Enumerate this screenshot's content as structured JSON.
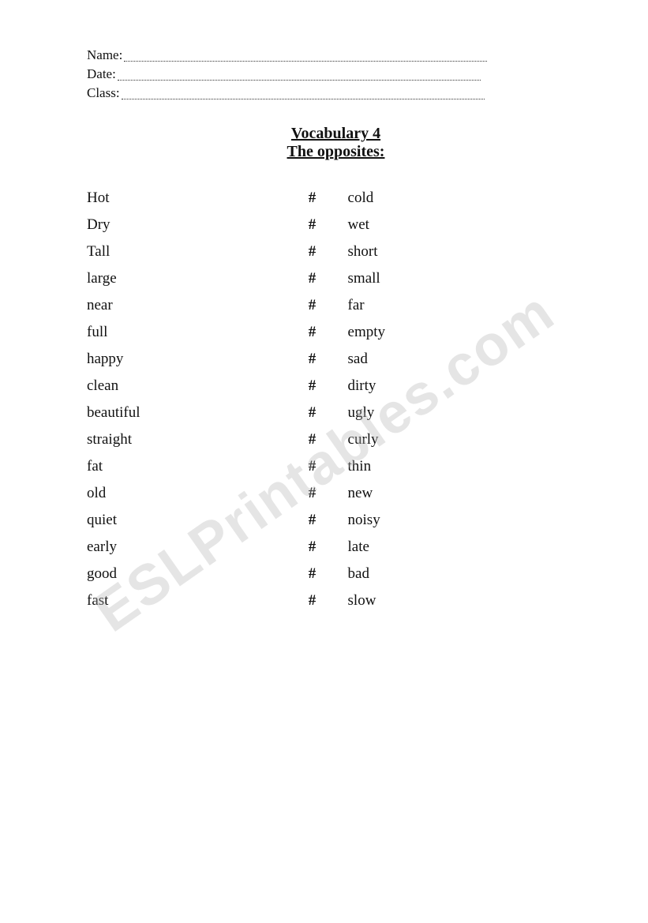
{
  "watermark": "ESLPrintables.com",
  "header": {
    "name_label": "Name:",
    "date_label": "Date:",
    "class_label": "Class:"
  },
  "title": {
    "line1": "Vocabulary 4",
    "line2": "The opposites:"
  },
  "pairs": [
    {
      "word1": "Hot",
      "word2": "cold"
    },
    {
      "word1": "Dry",
      "word2": "wet"
    },
    {
      "word1": "Tall",
      "word2": "short"
    },
    {
      "word1": "large",
      "word2": "small"
    },
    {
      "word1": "near",
      "word2": "far"
    },
    {
      "word1": "full",
      "word2": "empty"
    },
    {
      "word1": "happy",
      "word2": "sad"
    },
    {
      "word1": "clean",
      "word2": "dirty"
    },
    {
      "word1": "beautiful",
      "word2": "ugly"
    },
    {
      "word1": "straight",
      "word2": "curly"
    },
    {
      "word1": "fat",
      "word2": "thin"
    },
    {
      "word1": "old",
      "word2": "new"
    },
    {
      "word1": "quiet",
      "word2": "noisy"
    },
    {
      "word1": "early",
      "word2": "late"
    },
    {
      "word1": "good",
      "word2": "bad"
    },
    {
      "word1": "fast",
      "word2": "slow"
    }
  ],
  "separator": "#"
}
